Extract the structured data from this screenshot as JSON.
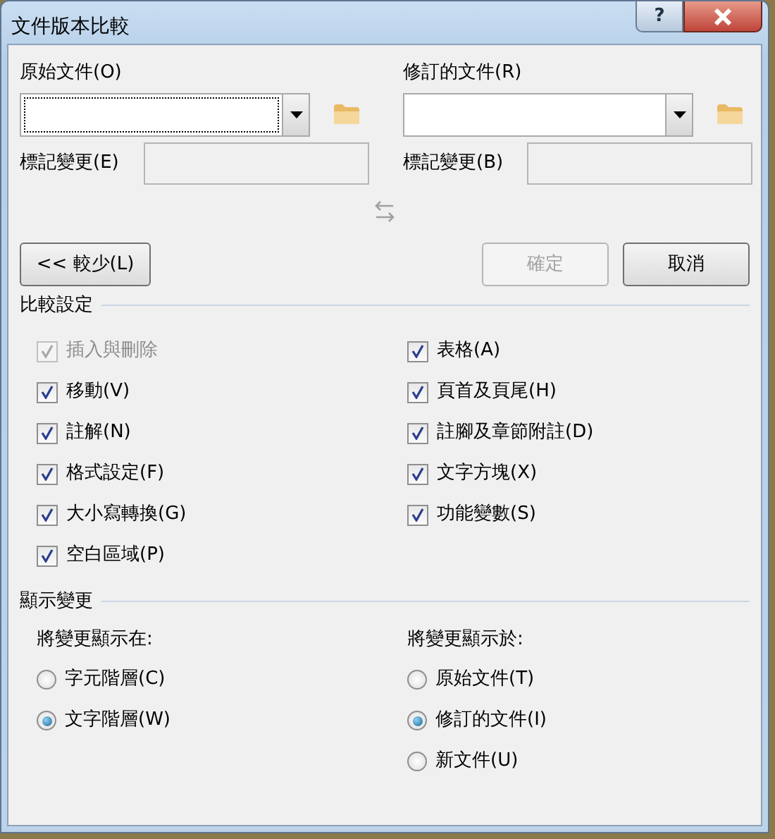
{
  "window": {
    "title": "文件版本比較",
    "help": "?"
  },
  "original": {
    "label": "原始文件(O)",
    "focused": true,
    "mark_label": "標記變更(E)"
  },
  "revised": {
    "label": "修訂的文件(R)",
    "focused": false,
    "mark_label": "標記變更(B)"
  },
  "less_button": {
    "label": "<< 較少(L)",
    "disabled": false
  },
  "ok_button": {
    "label": "確定",
    "disabled": true
  },
  "cancel_button": {
    "label": "取消",
    "disabled": false
  },
  "comparison_settings": {
    "title": "比較設定",
    "left_options": [
      {
        "label": "插入與刪除",
        "checked": true,
        "disabled": true
      },
      {
        "label": "移動(V)",
        "checked": true,
        "disabled": false
      },
      {
        "label": "註解(N)",
        "checked": true,
        "disabled": false
      },
      {
        "label": "格式設定(F)",
        "checked": true,
        "disabled": false
      },
      {
        "label": "大小寫轉換(G)",
        "checked": true,
        "disabled": false
      },
      {
        "label": "空白區域(P)",
        "checked": true,
        "disabled": false
      }
    ],
    "right_options": [
      {
        "label": "表格(A)",
        "checked": true,
        "disabled": false
      },
      {
        "label": "頁首及頁尾(H)",
        "checked": true,
        "disabled": false
      },
      {
        "label": "註腳及章節附註(D)",
        "checked": true,
        "disabled": false
      },
      {
        "label": "文字方塊(X)",
        "checked": true,
        "disabled": false
      },
      {
        "label": "功能變數(S)",
        "checked": true,
        "disabled": false
      }
    ]
  },
  "show_changes": {
    "title": "顯示變更",
    "groups": [
      {
        "label": "將變更顯示在:",
        "options": [
          {
            "label": "字元階層(C)",
            "selected": false
          },
          {
            "label": "文字階層(W)",
            "selected": true
          }
        ]
      },
      {
        "label": "將變更顯示於:",
        "options": [
          {
            "label": "原始文件(T)",
            "selected": false
          },
          {
            "label": "修訂的文件(I)",
            "selected": true
          },
          {
            "label": "新文件(U)",
            "selected": false
          }
        ]
      }
    ]
  }
}
